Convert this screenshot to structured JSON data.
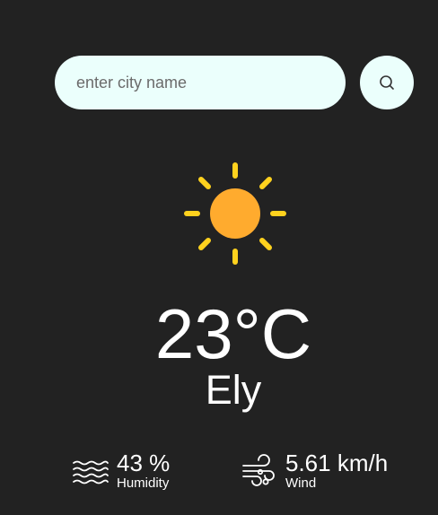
{
  "search": {
    "placeholder": "enter city name",
    "value": ""
  },
  "search_button": {
    "icon": "search-icon"
  },
  "weather": {
    "icon": "sun-icon",
    "temperature": "23°C",
    "city": "Ely"
  },
  "details": {
    "humidity": {
      "icon": "humidity-waves-icon",
      "value": "43 %",
      "label": "Humidity"
    },
    "wind": {
      "icon": "wind-icon",
      "value": "5.61 km/h",
      "label": "Wind"
    }
  },
  "colors": {
    "background": "#222222",
    "input_background": "#ebfffc",
    "sun_core": "#ffab2e",
    "sun_rays": "#ffd21e",
    "text": "#ffffff"
  }
}
